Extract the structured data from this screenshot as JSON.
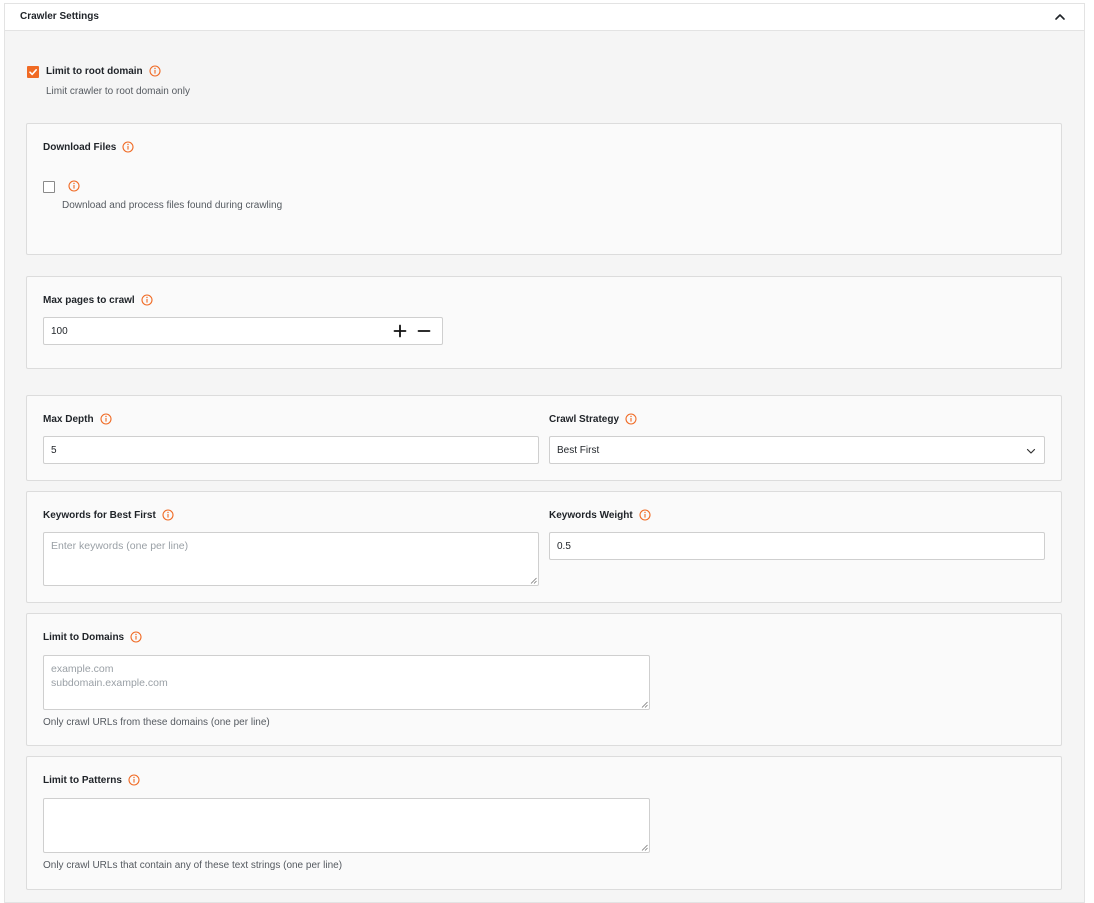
{
  "panel": {
    "title": "Crawler Settings"
  },
  "limit_root": {
    "checked": true,
    "label": "Limit to root domain",
    "help": "Limit crawler to root domain only"
  },
  "download_files": {
    "title": "Download Files",
    "checked": false,
    "help": "Download and process files found during crawling"
  },
  "max_pages": {
    "label": "Max pages to crawl",
    "value": "100"
  },
  "max_depth": {
    "label": "Max Depth",
    "value": "5"
  },
  "crawl_strategy": {
    "label": "Crawl Strategy",
    "selected": "Best First"
  },
  "keywords": {
    "label": "Keywords for Best First",
    "placeholder": "Enter keywords (one per line)"
  },
  "keywords_weight": {
    "label": "Keywords Weight",
    "value": "0.5"
  },
  "limit_domains": {
    "label": "Limit to Domains",
    "placeholder_line1": "example.com",
    "placeholder_line2": "subdomain.example.com",
    "help": "Only crawl URLs from these domains (one per line)"
  },
  "limit_patterns": {
    "label": "Limit to Patterns",
    "help": "Only crawl URLs that contain any of these text strings (one per line)"
  },
  "colors": {
    "accent": "#f06a24",
    "card_bg": "#fafafa",
    "panel_bg": "#f5f5f5",
    "border": "#dcdcdc"
  },
  "icons": {
    "info": "info-icon",
    "collapse": "chevron-up-icon",
    "plus": "plus-icon",
    "minus": "minus-icon",
    "dropdown": "chevron-down-icon",
    "check": "check-icon"
  }
}
